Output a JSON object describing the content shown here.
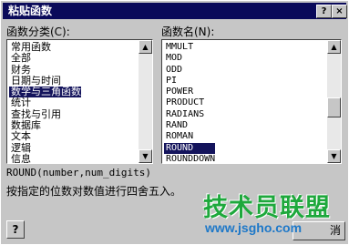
{
  "window": {
    "title": "粘贴函数",
    "help_glyph": "?",
    "close_glyph": "×"
  },
  "category": {
    "label": "函数分类(C):",
    "items": [
      "常用函数",
      "全部",
      "财务",
      "日期与时间",
      "数学与三角函数",
      "统计",
      "查找与引用",
      "数据库",
      "文本",
      "逻辑",
      "信息"
    ],
    "selected": "数学与三角函数"
  },
  "function": {
    "label": "函数名(N):",
    "items": [
      "MMULT",
      "MOD",
      "ODD",
      "PI",
      "POWER",
      "PRODUCT",
      "RADIANS",
      "RAND",
      "ROMAN",
      "ROUND",
      "ROUNDDOWN"
    ],
    "selected": "ROUND"
  },
  "syntax": "ROUND(number,num_digits)",
  "description": "按指定的位数对数值进行四舍五入。",
  "buttons": {
    "help_glyph": "?",
    "partial_label": "消"
  },
  "watermark": {
    "cn": "技术员联盟",
    "url": "www.jsgho.com"
  }
}
